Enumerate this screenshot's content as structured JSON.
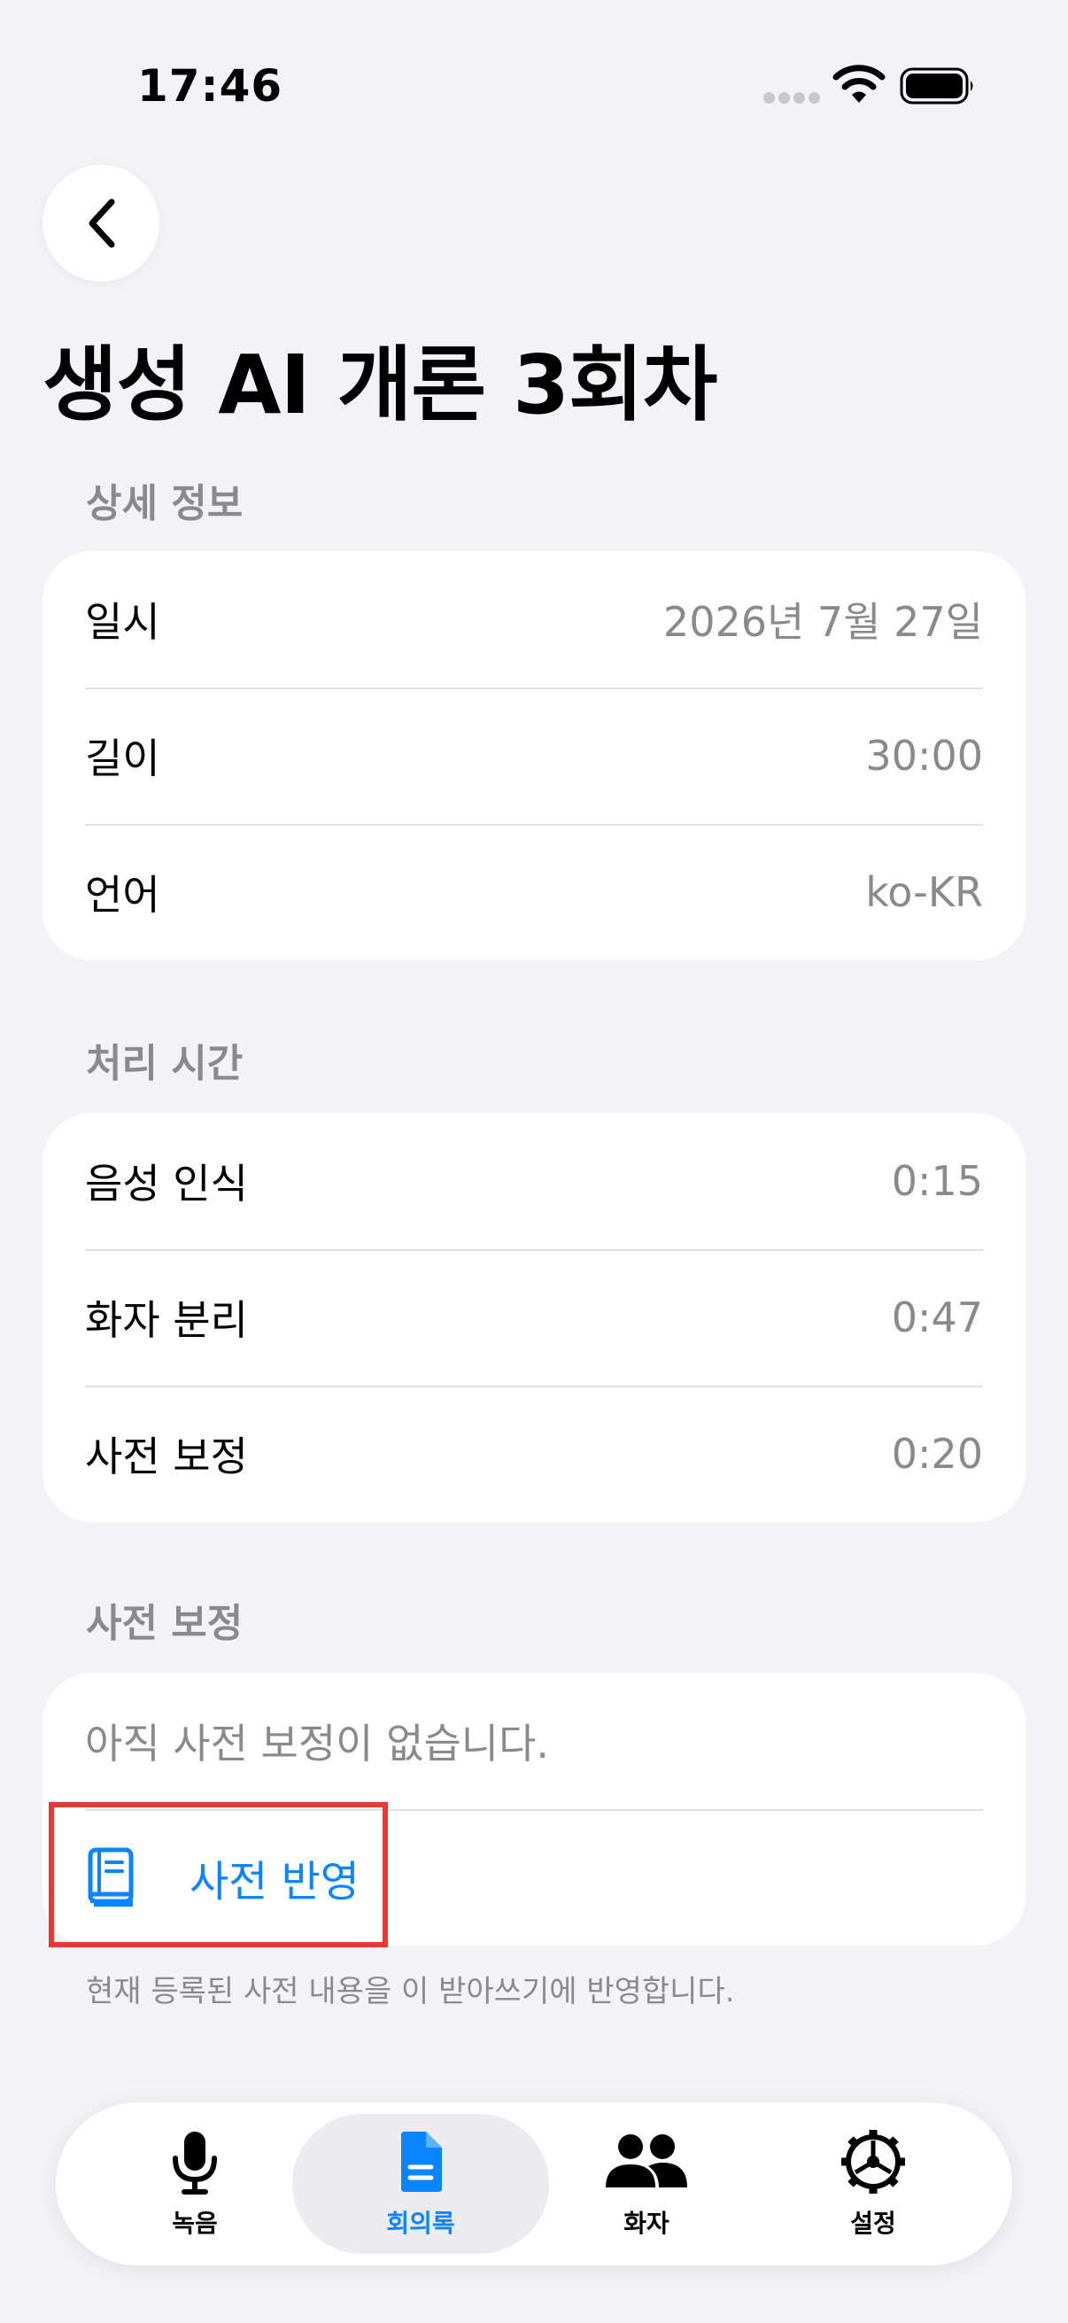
{
  "status_bar": {
    "time": "17:46"
  },
  "header": {
    "title": "생성 AI 개론 3회차"
  },
  "details": {
    "header": "상세 정보",
    "rows": [
      {
        "label": "일시",
        "value": "2026년 7월 27일"
      },
      {
        "label": "길이",
        "value": "30:00"
      },
      {
        "label": "언어",
        "value": "ko-KR"
      }
    ]
  },
  "processing": {
    "header": "처리 시간",
    "rows": [
      {
        "label": "음성 인식",
        "value": "0:15"
      },
      {
        "label": "화자 분리",
        "value": "0:47"
      },
      {
        "label": "사전 보정",
        "value": "0:20"
      }
    ]
  },
  "dictionary": {
    "header": "사전 보정",
    "empty_text": "아직 사전 보정이 없습니다.",
    "action_label": "사전 반영",
    "footnote": "현재 등록된 사전 내용을 이 받아쓰기에 반영합니다."
  },
  "tabs": [
    {
      "label": "녹음",
      "icon": "mic-icon"
    },
    {
      "label": "회의록",
      "icon": "document-icon",
      "active": true
    },
    {
      "label": "화자",
      "icon": "people-icon"
    },
    {
      "label": "설정",
      "icon": "gear-icon"
    }
  ],
  "colors": {
    "accent": "#0a84ff",
    "highlight": "#e53935",
    "background": "#f2f2f7"
  }
}
